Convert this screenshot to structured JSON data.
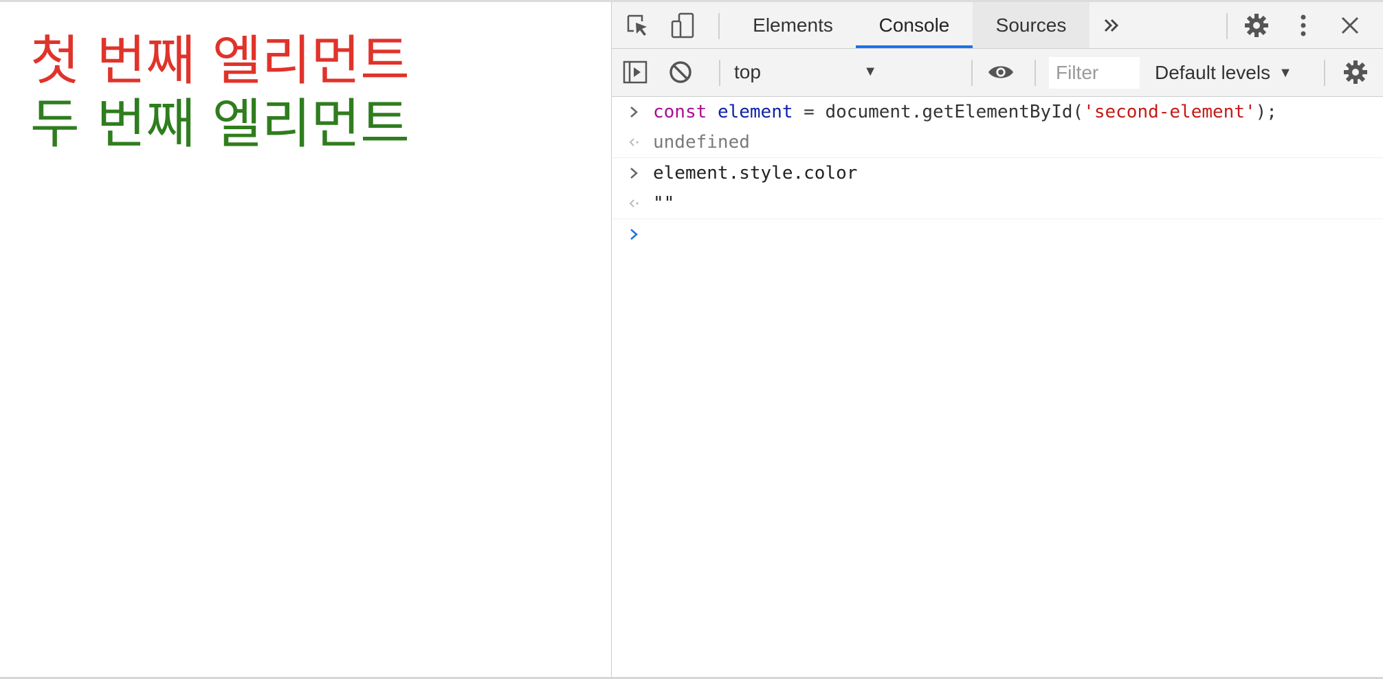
{
  "page": {
    "first_element_text": "첫 번째 엘리먼트",
    "second_element_text": "두 번째 엘리먼트",
    "first_color": "#e0332a",
    "second_color": "#2f7d1e"
  },
  "devtools": {
    "tabs": [
      {
        "label": "Elements"
      },
      {
        "label": "Console"
      },
      {
        "label": "Sources"
      }
    ],
    "active_tab": "Console",
    "more_tabs_icon": "chevron-double-right-icon",
    "toolbar": {
      "context": "top",
      "filter_placeholder": "Filter",
      "levels_label": "Default levels"
    },
    "console": {
      "entries": [
        {
          "input": {
            "keyword": "const",
            "variable": "element",
            "operator": " = ",
            "call": "document.getElementById(",
            "string": "'second-element'",
            "end": ");"
          },
          "output": "undefined"
        },
        {
          "input_text": "element.style.color",
          "output": "\"\""
        }
      ]
    }
  },
  "colors": {
    "accent": "#1a73e8",
    "toolbar_bg": "#f3f3f3"
  }
}
